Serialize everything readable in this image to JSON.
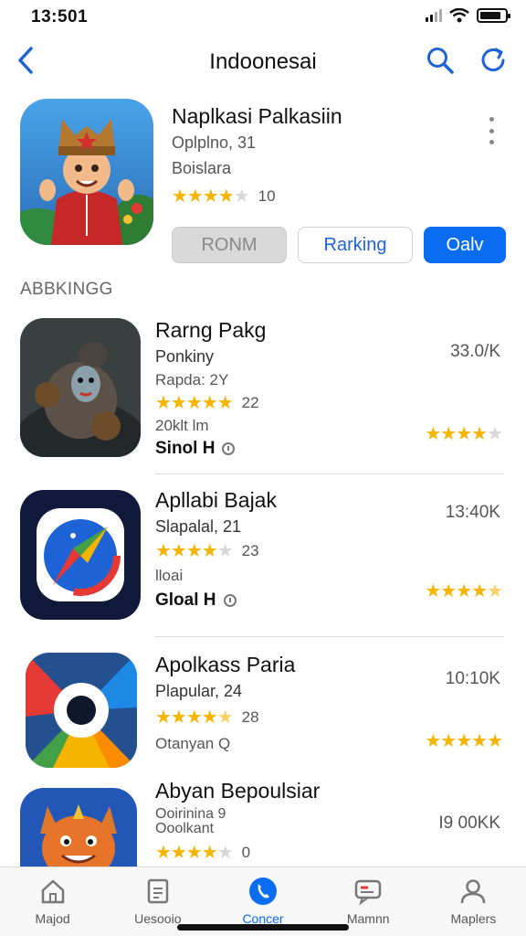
{
  "status": {
    "time": "13:501"
  },
  "nav": {
    "title": "Indoonesai"
  },
  "featured": {
    "title": "Naplkasi Palkasiin",
    "sub1": "Oplplno, 31",
    "sub2": "Boislara",
    "rating_stars": 3.5,
    "rating_text": "10",
    "buttons": {
      "grey": "RONM",
      "outline": "Rarking",
      "primary": "Oalv"
    }
  },
  "section_label": "ABBKINGG",
  "list": {
    "items": [
      {
        "title": "Rarng Pakg",
        "line1": "Ponkiny",
        "line2": "Rapda: 2Y",
        "stars": 5,
        "rating_text": "22",
        "line3": "20klt lm",
        "bold": "Sinol H",
        "right_text": "33.0/K",
        "right_stars": 3.5
      },
      {
        "title": "Apllabi Bajak",
        "line1": "Slapalal, 21",
        "stars": 4,
        "rating_text": "23",
        "line3": "lloai",
        "bold": "Gloal H",
        "right_text": "13:40K",
        "right_stars": 4.5
      },
      {
        "title": "Apolkass Paria",
        "line1": "Plapular, 24",
        "stars": 4.5,
        "rating_text": "28",
        "line3": "Otanyan Q",
        "right_text": "10:10K",
        "right_stars": 5
      },
      {
        "title": "Abyan Bepoulsiar",
        "line1": "Ooirinina 9",
        "line2": "Ooolkant",
        "stars": 4,
        "rating_text": "0",
        "right_text": "I9 00KK"
      }
    ]
  },
  "tabs": [
    {
      "label": "Majod",
      "icon": "home-icon"
    },
    {
      "label": "Uesooio",
      "icon": "document-icon"
    },
    {
      "label": "Concer",
      "icon": "phone-icon",
      "active": true
    },
    {
      "label": "Mamnn",
      "icon": "chat-icon"
    },
    {
      "label": "Maplers",
      "icon": "person-icon"
    }
  ],
  "colors": {
    "accent": "#0a6cf0",
    "star": "#f4b400"
  }
}
